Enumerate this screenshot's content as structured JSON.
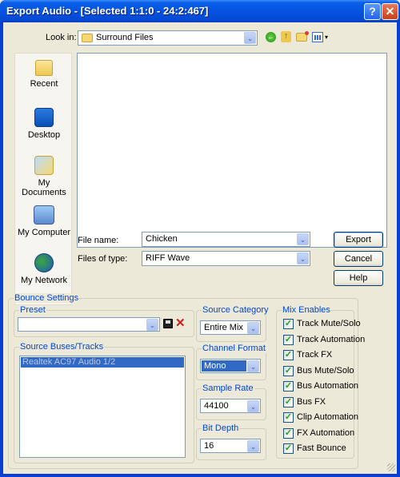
{
  "window": {
    "title": "Export Audio - [Selected 1:1:0 - 24:2:467]"
  },
  "title_buttons": {
    "help": "?",
    "close": "✕"
  },
  "look_in": {
    "label": "Look in:",
    "value": "Surround Files"
  },
  "toolbar_icons": [
    "back-icon",
    "up-folder-icon",
    "new-folder-icon",
    "view-menu-icon"
  ],
  "places": [
    {
      "label": "Recent",
      "icon": "recent-folder-icon"
    },
    {
      "label": "Desktop",
      "icon": "desktop-icon"
    },
    {
      "label": "My Documents",
      "icon": "my-documents-icon"
    },
    {
      "label": "My Computer",
      "icon": "my-computer-icon"
    },
    {
      "label": "My Network",
      "icon": "my-network-icon"
    }
  ],
  "file_name": {
    "label": "File name:",
    "value": "Chicken"
  },
  "file_type": {
    "label": "Files of type:",
    "value": "RIFF Wave"
  },
  "buttons": {
    "export": "Export",
    "cancel": "Cancel",
    "help": "Help"
  },
  "bounce": {
    "title": "Bounce Settings",
    "preset": {
      "label": "Preset",
      "value": ""
    },
    "source_tracks": {
      "label": "Source Buses/Tracks",
      "items": [
        "Realtek AC97 Audio 1/2"
      ]
    },
    "source_category": {
      "label": "Source Category",
      "value": "Entire Mix"
    },
    "channel_format": {
      "label": "Channel Format",
      "value": "Mono"
    },
    "sample_rate": {
      "label": "Sample Rate",
      "value": "44100"
    },
    "bit_depth": {
      "label": "Bit Depth",
      "value": "16"
    },
    "mix_enables": {
      "label": "Mix Enables",
      "items": [
        {
          "label": "Track Mute/Solo",
          "checked": true
        },
        {
          "label": "Track Automation",
          "checked": true
        },
        {
          "label": "Track FX",
          "checked": true
        },
        {
          "label": "Bus Mute/Solo",
          "checked": true
        },
        {
          "label": "Bus Automation",
          "checked": true
        },
        {
          "label": "Bus FX",
          "checked": true
        },
        {
          "label": "Clip Automation",
          "checked": true
        },
        {
          "label": "FX Automation",
          "checked": true
        },
        {
          "label": "Fast Bounce",
          "checked": true
        }
      ]
    }
  },
  "colors": {
    "title_blue": "#0553e0",
    "group_label": "#0046d5",
    "selection": "#316ac5"
  }
}
